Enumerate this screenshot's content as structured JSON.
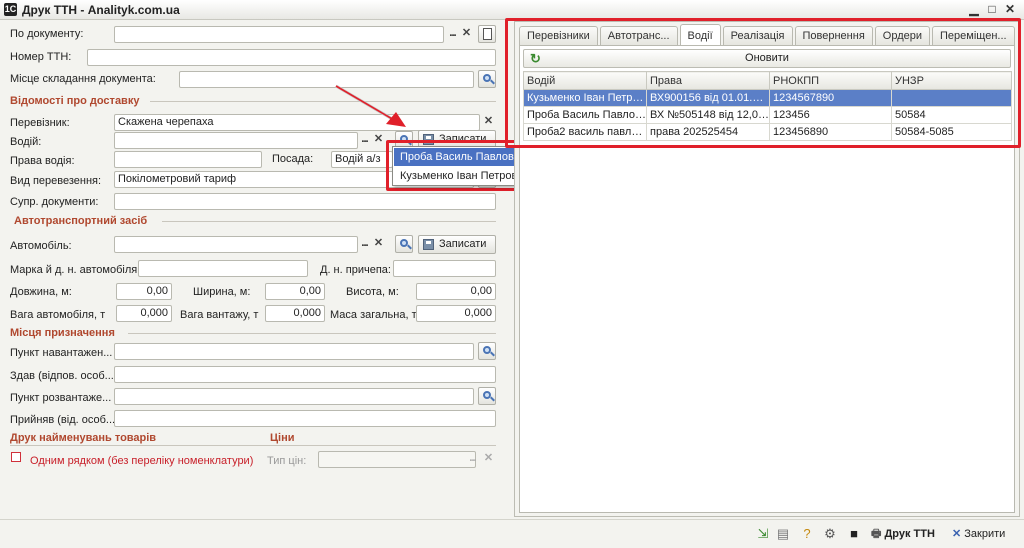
{
  "window": {
    "title": "Друк ТТН - Analityk.com.ua",
    "logo": "1С"
  },
  "form": {
    "po_dokumentu": {
      "label": "По документу:",
      "value": ""
    },
    "nomer_ttn": {
      "label": "Номер ТТН:",
      "value": ""
    },
    "misce": {
      "label": "Місце складання документа:",
      "value": ""
    },
    "delivery_section": "Відомості про доставку",
    "pereviznyk": {
      "label": "Перевізник:",
      "value": "Скажена черепаха"
    },
    "vodiy": {
      "label": "Водій:",
      "value": ""
    },
    "prava": {
      "label": "Права водія:",
      "value": ""
    },
    "posada": {
      "label": "Посада:",
      "value": "Водій а/з"
    },
    "vyd": {
      "label": "Вид перевезення:",
      "value": "Покілометровий тариф"
    },
    "supr": {
      "label": "Супр. документи:",
      "value": ""
    },
    "vehicle_section": "Автотранспортний засіб",
    "avtomobil": {
      "label": "Автомобіль:",
      "value": ""
    },
    "marka": {
      "label": "Марка й д. н. автомобіля:",
      "value": ""
    },
    "prychepa": {
      "label": "Д. н. причепа:",
      "value": ""
    },
    "dovzhyna": {
      "label": "Довжина, м:",
      "value": "0,00"
    },
    "shyryna": {
      "label": "Ширина, м:",
      "value": "0,00"
    },
    "vysota": {
      "label": "Висота, м:",
      "value": "0,00"
    },
    "vaga_avto": {
      "label": "Вага автомобіля, т",
      "value": "0,000"
    },
    "vaga_vantazh": {
      "label": "Вага вантажу, т",
      "value": "0,000"
    },
    "masa": {
      "label": "Маса загальна, т:",
      "value": "0,000"
    },
    "dest_section": "Місця призначення",
    "punkt_nav": {
      "label": "Пункт навантажен...",
      "value": ""
    },
    "zdav": {
      "label": "Здав (відпов. особ...",
      "value": ""
    },
    "punkt_rozv": {
      "label": "Пункт розвантаже...",
      "value": ""
    },
    "pryynyav": {
      "label": "Прийняв (від. особ...",
      "value": ""
    },
    "goods_section": "Друк найменувань товарів",
    "prices_section": "Ціни",
    "one_row": {
      "label": "Одним рядком (без переліку номенклатури)",
      "checked": false
    },
    "typ_cin": {
      "label": "Тип цін:",
      "value": ""
    },
    "save_label": "Записати"
  },
  "dropdown": {
    "items": [
      "Проба Василь Павлович",
      "Кузьменко Іван Петрович"
    ],
    "selected_index": 0
  },
  "tabs": [
    {
      "label": "Перевізники",
      "active": false
    },
    {
      "label": "Автотранс...",
      "active": false
    },
    {
      "label": "Водії",
      "active": true
    },
    {
      "label": "Реалізація",
      "active": false
    },
    {
      "label": "Повернення",
      "active": false
    },
    {
      "label": "Ордери",
      "active": false
    },
    {
      "label": "Переміщен...",
      "active": false
    }
  ],
  "refresh_label": "Оновити",
  "table": {
    "columns": [
      "Водій",
      "Права",
      "РНОКПП",
      "УНЗР"
    ],
    "rows": [
      [
        "Кузьменко Іван Петро...",
        "ВХ900156 від 01.01.2012...",
        "1234567890",
        ""
      ],
      [
        "Проба Василь Павлов...",
        "ВХ №505148 від 12,05.2...",
        "123456",
        "50584"
      ],
      [
        "Проба2 василь павло...",
        "права 202525454",
        "123456890",
        "50584-5085"
      ]
    ],
    "selected_row": 0
  },
  "statusbar": {
    "print_label": "Друк ТТН",
    "close_label": "Закрити"
  },
  "colors": {
    "accent_red": "#e0202a",
    "section_text": "#b0482f",
    "selection": "#5b7fc7"
  }
}
